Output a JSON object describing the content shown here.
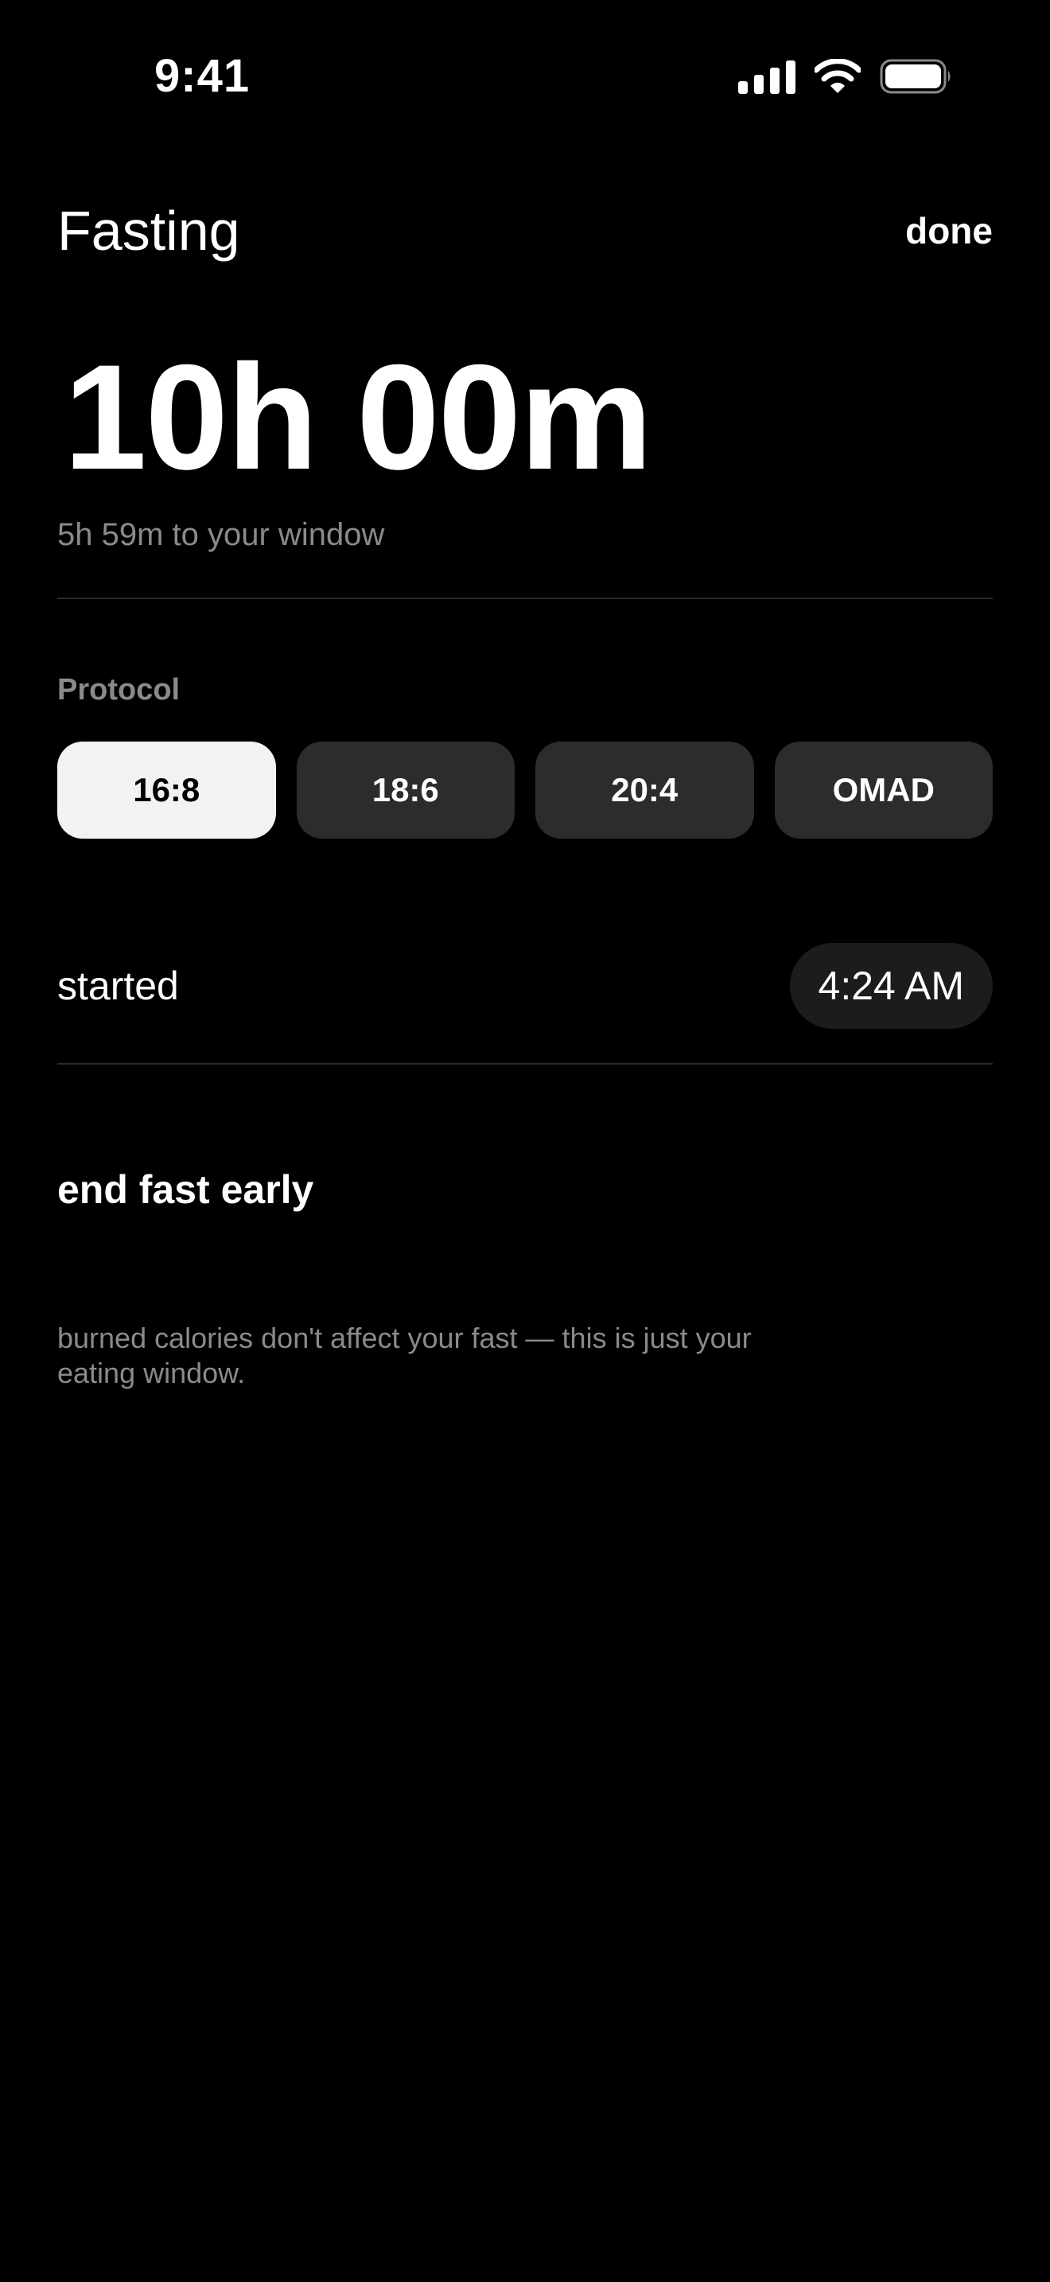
{
  "status_bar": {
    "time": "9:41",
    "icons": [
      "cellular-signal-icon",
      "wifi-icon",
      "battery-icon"
    ]
  },
  "header": {
    "title": "Fasting",
    "done_label": "done"
  },
  "timer": {
    "elapsed": "10h 00m",
    "remaining": "5h 59m to your window"
  },
  "protocol": {
    "label": "Protocol",
    "options": [
      "16:8",
      "18:6",
      "20:4",
      "OMAD"
    ],
    "selected": "16:8"
  },
  "started": {
    "label": "started",
    "time": "4:24 AM"
  },
  "actions": {
    "end_early_label": "end fast early"
  },
  "footnote": "burned calories don't affect your fast — this is just your eating window.",
  "colors": {
    "background": "#000000",
    "text": "#ffffff",
    "secondary_text": "#8a8a8e",
    "chip_background": "#2c2c2e",
    "chip_selected": "#f2f2f2",
    "pill_background": "#1c1c1e",
    "divider": "#2a2a2c"
  }
}
